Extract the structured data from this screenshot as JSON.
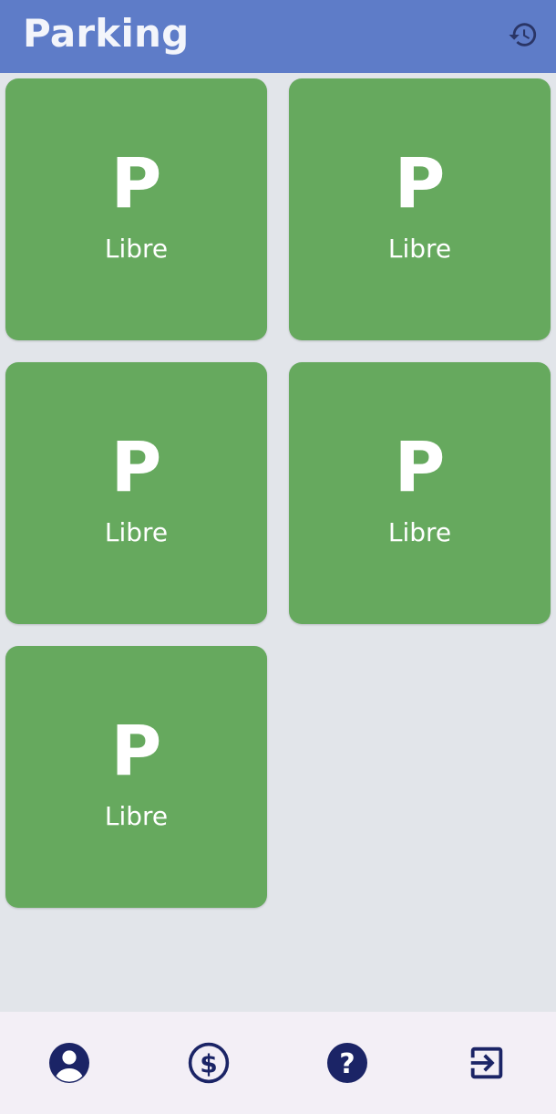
{
  "app_bar": {
    "title": "Parking",
    "background": "#5e7cc8",
    "history_icon": "history-icon"
  },
  "spots": [
    {
      "letter": "P",
      "status": "Libre",
      "color": "#66a95e"
    },
    {
      "letter": "P",
      "status": "Libre",
      "color": "#66a95e"
    },
    {
      "letter": "P",
      "status": "Libre",
      "color": "#66a95e"
    },
    {
      "letter": "P",
      "status": "Libre",
      "color": "#66a95e"
    },
    {
      "letter": "P",
      "status": "Libre",
      "color": "#66a95e"
    }
  ],
  "bottom_nav": {
    "background": "#f3eff6",
    "icon_color": "#1b2466",
    "items": [
      {
        "icon": "account-circle-icon"
      },
      {
        "icon": "dollar-circle-icon"
      },
      {
        "icon": "help-circle-icon"
      },
      {
        "icon": "logout-icon"
      }
    ]
  }
}
